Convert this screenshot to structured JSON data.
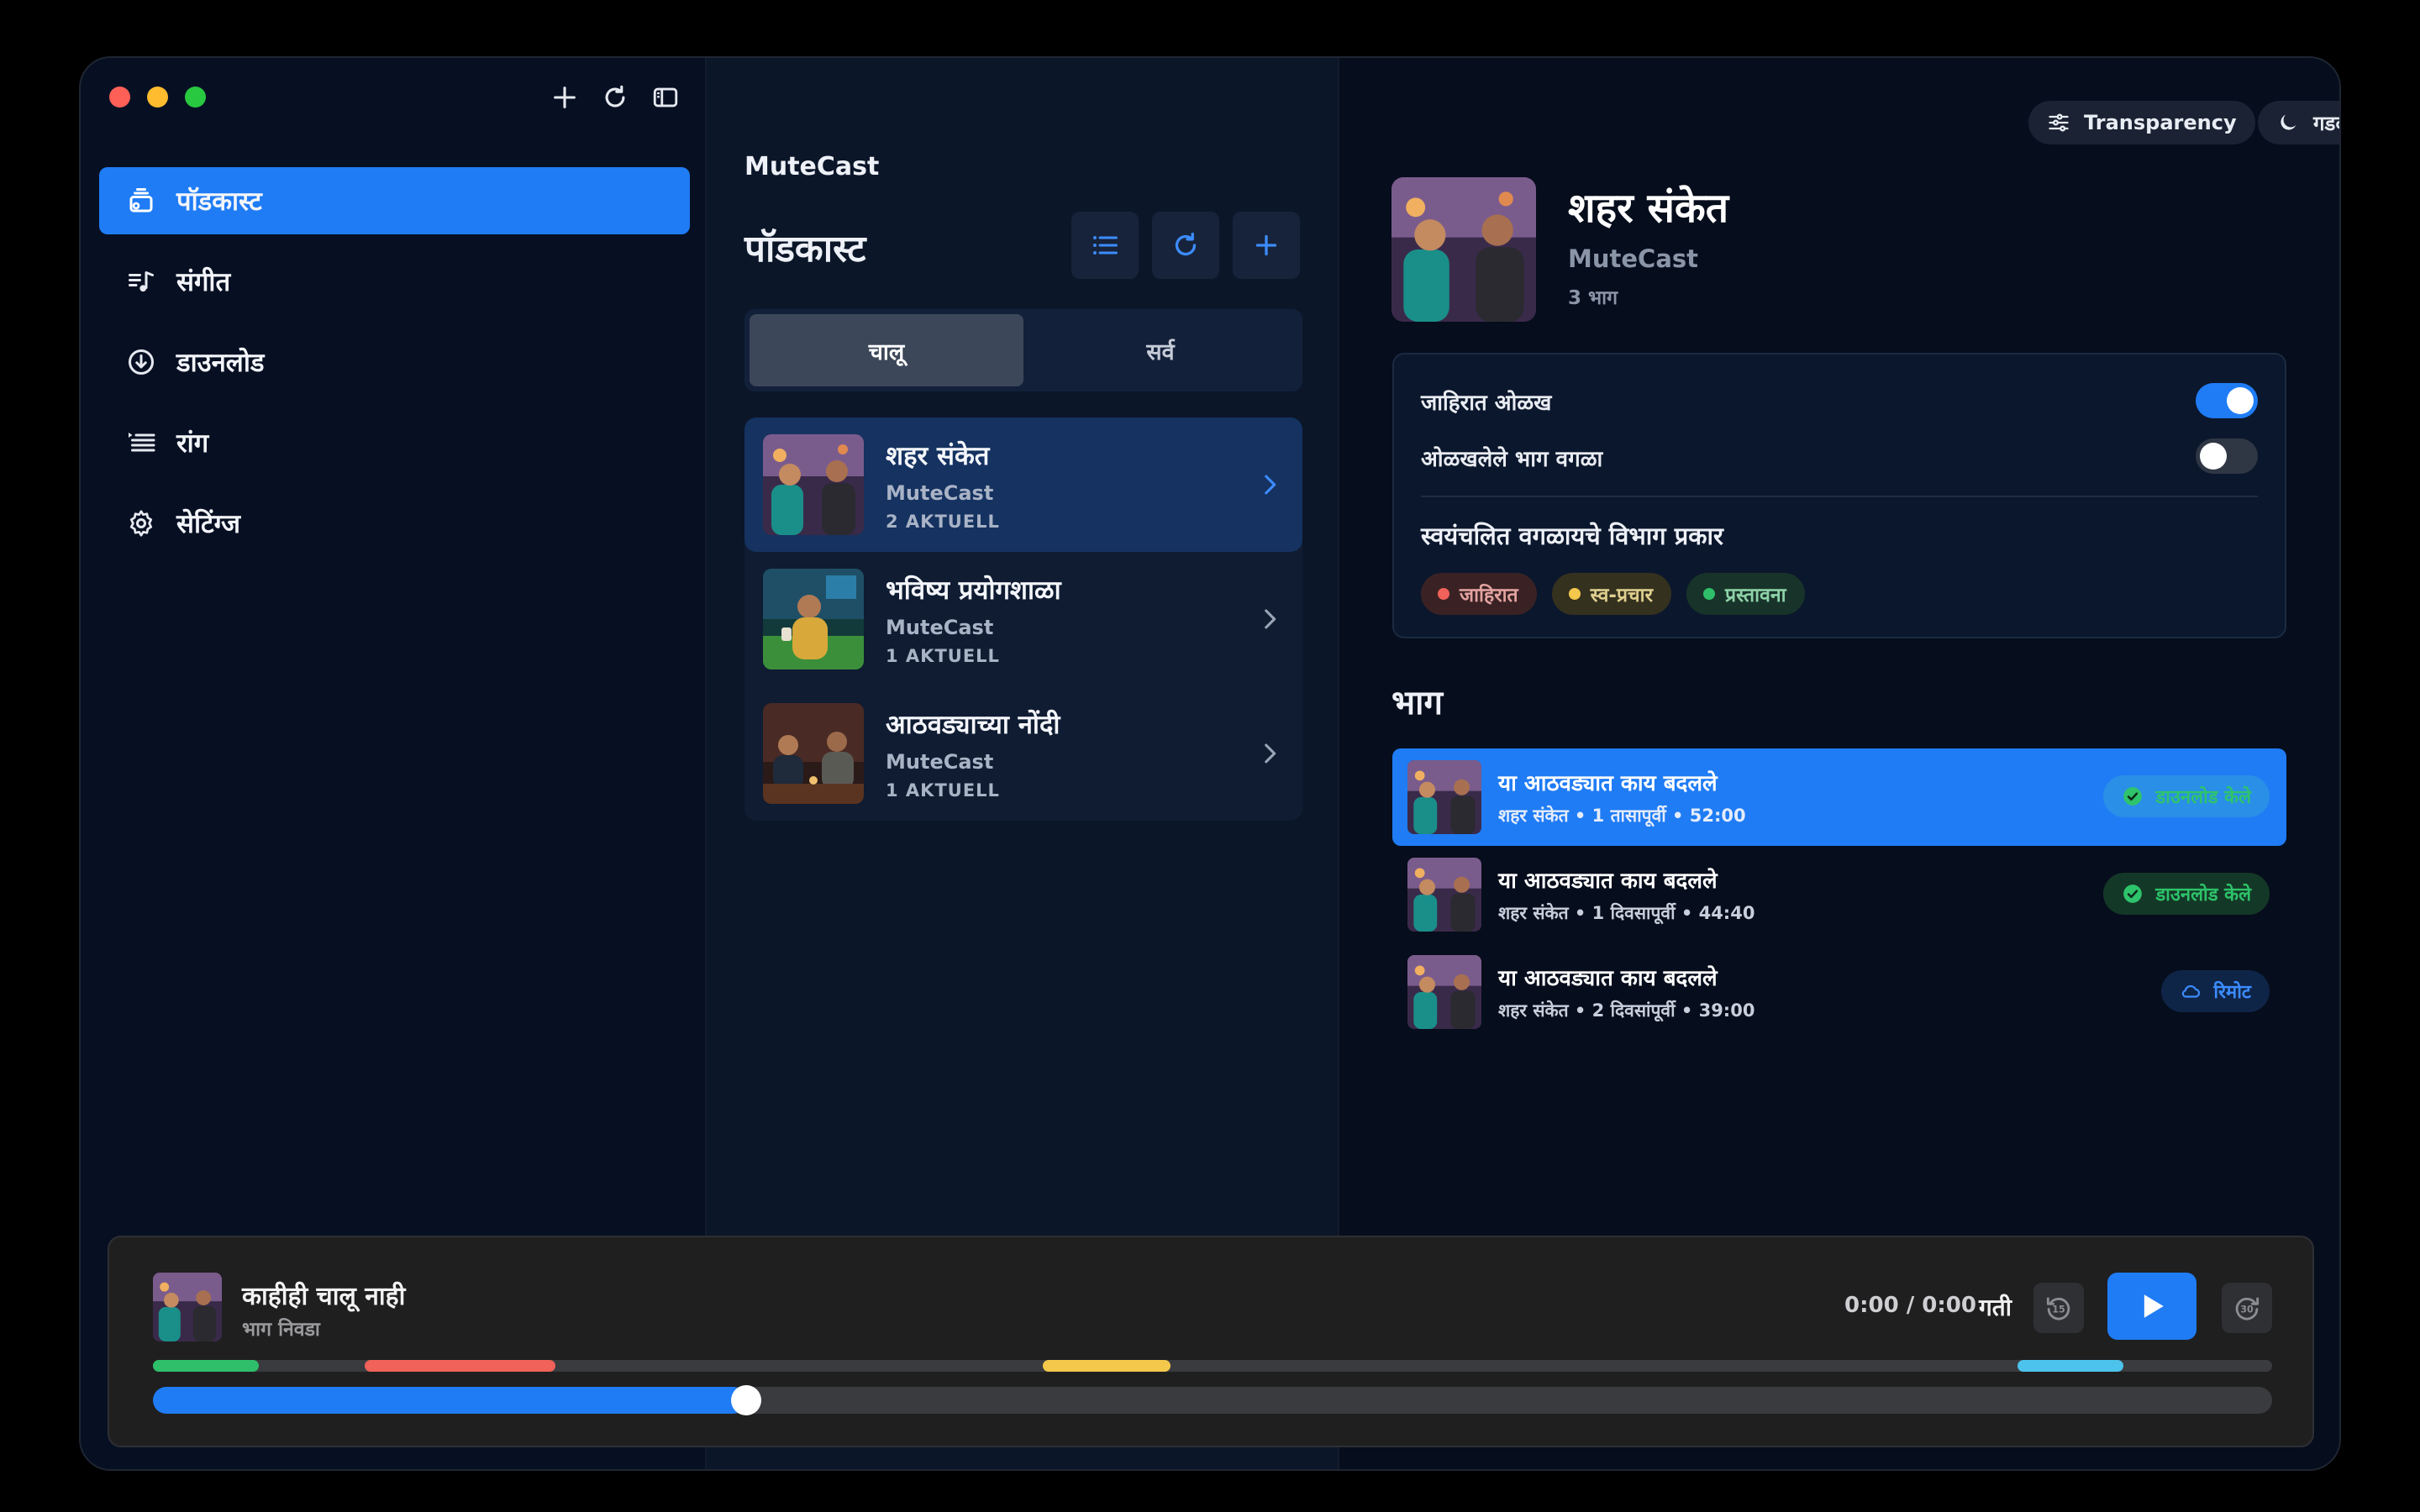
{
  "sidebar": {
    "items": [
      {
        "label": "पॉडकास्ट",
        "icon": "podcast-icon",
        "active": true
      },
      {
        "label": "संगीत",
        "icon": "music-icon",
        "active": false
      },
      {
        "label": "डाउनलोड",
        "icon": "download-icon",
        "active": false
      },
      {
        "label": "रांग",
        "icon": "queue-icon",
        "active": false
      },
      {
        "label": "सेटिंग्ज",
        "icon": "gear-icon",
        "active": false
      }
    ]
  },
  "middle": {
    "app_title": "MuteCast",
    "heading": "पॉडकास्ट",
    "tabs": [
      {
        "label": "चालू",
        "active": true
      },
      {
        "label": "सर्व",
        "active": false
      }
    ],
    "podcasts": [
      {
        "name": "शहर संकेत",
        "author": "MuteCast",
        "meta": "2 AKTUELL"
      },
      {
        "name": "भविष्य प्रयोगशाळा",
        "author": "MuteCast",
        "meta": "1 AKTUELL"
      },
      {
        "name": "आठवड्याच्या नोंदी",
        "author": "MuteCast",
        "meta": "1 AKTUELL"
      }
    ]
  },
  "right": {
    "transparency_label": "Transparency",
    "theme_label": "गडद",
    "podcast_title": "शहर संकेत",
    "podcast_author": "MuteCast",
    "episode_count": "3 भाग",
    "settings": {
      "toggle1_label": "जाहिरात ओळख",
      "toggle1_on": true,
      "toggle2_label": "ओळखलेले भाग वगळा",
      "toggle2_on": false,
      "categories_heading": "स्वयंचलित वगळायचे विभाग प्रकार",
      "chips": [
        {
          "label": "जाहिरात",
          "color": "#f0625a"
        },
        {
          "label": "स्व-प्रचार",
          "color": "#f3c84b"
        },
        {
          "label": "प्रस्तावना",
          "color": "#2fbf6a"
        }
      ]
    },
    "episodes_heading": "भाग",
    "episodes": [
      {
        "title": "या आठवड्यात काय बदलले",
        "meta": "शहर संकेत • 1 तासापूर्वी • 52:00",
        "badge": "डाउनलोड केले",
        "badge_type": "downloaded"
      },
      {
        "title": "या आठवड्यात काय बदलले",
        "meta": "शहर संकेत • 1 दिवसापूर्वी • 44:40",
        "badge": "डाउनलोड केले",
        "badge_type": "downloaded"
      },
      {
        "title": "या आठवड्यात काय बदलले",
        "meta": "शहर संकेत • 2 दिवसांपूर्वी • 39:00",
        "badge": "रिमोट",
        "badge_type": "remote"
      }
    ]
  },
  "player": {
    "title": "काहीही चालू नाही",
    "subtitle": "भाग निवडा",
    "time": "0:00 / 0:00",
    "speed_label": "गती",
    "progress": 0.28,
    "segments": [
      {
        "start": 0.0,
        "end": 0.05,
        "color": "#2fbf6a"
      },
      {
        "start": 0.1,
        "end": 0.19,
        "color": "#f0625a"
      },
      {
        "start": 0.42,
        "end": 0.48,
        "color": "#f3c84b"
      },
      {
        "start": 0.88,
        "end": 0.93,
        "color": "#4cc3ec"
      }
    ]
  },
  "colors": {
    "accent": "#1f7cf5"
  }
}
